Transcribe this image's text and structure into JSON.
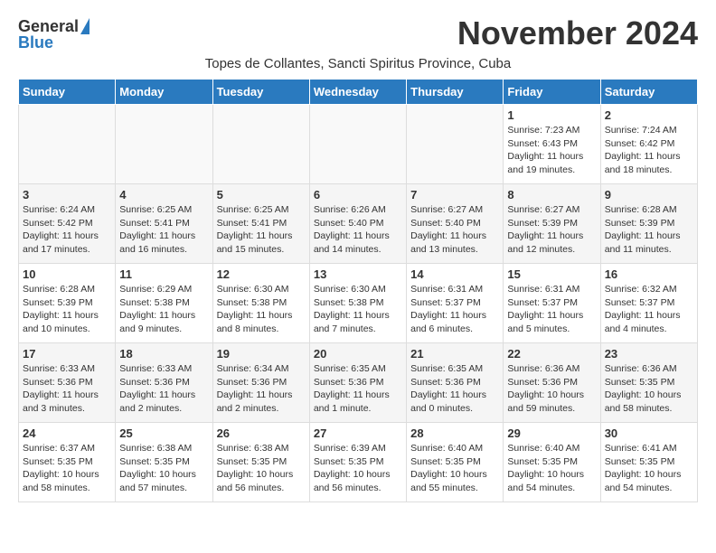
{
  "header": {
    "logo_general": "General",
    "logo_blue": "Blue",
    "title": "November 2024",
    "subtitle": "Topes de Collantes, Sancti Spiritus Province, Cuba"
  },
  "days_of_week": [
    "Sunday",
    "Monday",
    "Tuesday",
    "Wednesday",
    "Thursday",
    "Friday",
    "Saturday"
  ],
  "weeks": [
    [
      {
        "day": "",
        "content": ""
      },
      {
        "day": "",
        "content": ""
      },
      {
        "day": "",
        "content": ""
      },
      {
        "day": "",
        "content": ""
      },
      {
        "day": "",
        "content": ""
      },
      {
        "day": "1",
        "content": "Sunrise: 7:23 AM\nSunset: 6:43 PM\nDaylight: 11 hours and 19 minutes."
      },
      {
        "day": "2",
        "content": "Sunrise: 7:24 AM\nSunset: 6:42 PM\nDaylight: 11 hours and 18 minutes."
      }
    ],
    [
      {
        "day": "3",
        "content": "Sunrise: 6:24 AM\nSunset: 5:42 PM\nDaylight: 11 hours and 17 minutes."
      },
      {
        "day": "4",
        "content": "Sunrise: 6:25 AM\nSunset: 5:41 PM\nDaylight: 11 hours and 16 minutes."
      },
      {
        "day": "5",
        "content": "Sunrise: 6:25 AM\nSunset: 5:41 PM\nDaylight: 11 hours and 15 minutes."
      },
      {
        "day": "6",
        "content": "Sunrise: 6:26 AM\nSunset: 5:40 PM\nDaylight: 11 hours and 14 minutes."
      },
      {
        "day": "7",
        "content": "Sunrise: 6:27 AM\nSunset: 5:40 PM\nDaylight: 11 hours and 13 minutes."
      },
      {
        "day": "8",
        "content": "Sunrise: 6:27 AM\nSunset: 5:39 PM\nDaylight: 11 hours and 12 minutes."
      },
      {
        "day": "9",
        "content": "Sunrise: 6:28 AM\nSunset: 5:39 PM\nDaylight: 11 hours and 11 minutes."
      }
    ],
    [
      {
        "day": "10",
        "content": "Sunrise: 6:28 AM\nSunset: 5:39 PM\nDaylight: 11 hours and 10 minutes."
      },
      {
        "day": "11",
        "content": "Sunrise: 6:29 AM\nSunset: 5:38 PM\nDaylight: 11 hours and 9 minutes."
      },
      {
        "day": "12",
        "content": "Sunrise: 6:30 AM\nSunset: 5:38 PM\nDaylight: 11 hours and 8 minutes."
      },
      {
        "day": "13",
        "content": "Sunrise: 6:30 AM\nSunset: 5:38 PM\nDaylight: 11 hours and 7 minutes."
      },
      {
        "day": "14",
        "content": "Sunrise: 6:31 AM\nSunset: 5:37 PM\nDaylight: 11 hours and 6 minutes."
      },
      {
        "day": "15",
        "content": "Sunrise: 6:31 AM\nSunset: 5:37 PM\nDaylight: 11 hours and 5 minutes."
      },
      {
        "day": "16",
        "content": "Sunrise: 6:32 AM\nSunset: 5:37 PM\nDaylight: 11 hours and 4 minutes."
      }
    ],
    [
      {
        "day": "17",
        "content": "Sunrise: 6:33 AM\nSunset: 5:36 PM\nDaylight: 11 hours and 3 minutes."
      },
      {
        "day": "18",
        "content": "Sunrise: 6:33 AM\nSunset: 5:36 PM\nDaylight: 11 hours and 2 minutes."
      },
      {
        "day": "19",
        "content": "Sunrise: 6:34 AM\nSunset: 5:36 PM\nDaylight: 11 hours and 2 minutes."
      },
      {
        "day": "20",
        "content": "Sunrise: 6:35 AM\nSunset: 5:36 PM\nDaylight: 11 hours and 1 minute."
      },
      {
        "day": "21",
        "content": "Sunrise: 6:35 AM\nSunset: 5:36 PM\nDaylight: 11 hours and 0 minutes."
      },
      {
        "day": "22",
        "content": "Sunrise: 6:36 AM\nSunset: 5:36 PM\nDaylight: 10 hours and 59 minutes."
      },
      {
        "day": "23",
        "content": "Sunrise: 6:36 AM\nSunset: 5:35 PM\nDaylight: 10 hours and 58 minutes."
      }
    ],
    [
      {
        "day": "24",
        "content": "Sunrise: 6:37 AM\nSunset: 5:35 PM\nDaylight: 10 hours and 58 minutes."
      },
      {
        "day": "25",
        "content": "Sunrise: 6:38 AM\nSunset: 5:35 PM\nDaylight: 10 hours and 57 minutes."
      },
      {
        "day": "26",
        "content": "Sunrise: 6:38 AM\nSunset: 5:35 PM\nDaylight: 10 hours and 56 minutes."
      },
      {
        "day": "27",
        "content": "Sunrise: 6:39 AM\nSunset: 5:35 PM\nDaylight: 10 hours and 56 minutes."
      },
      {
        "day": "28",
        "content": "Sunrise: 6:40 AM\nSunset: 5:35 PM\nDaylight: 10 hours and 55 minutes."
      },
      {
        "day": "29",
        "content": "Sunrise: 6:40 AM\nSunset: 5:35 PM\nDaylight: 10 hours and 54 minutes."
      },
      {
        "day": "30",
        "content": "Sunrise: 6:41 AM\nSunset: 5:35 PM\nDaylight: 10 hours and 54 minutes."
      }
    ]
  ]
}
